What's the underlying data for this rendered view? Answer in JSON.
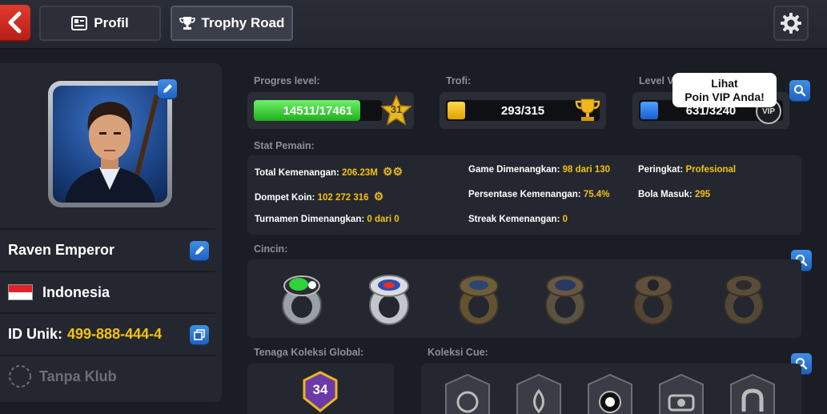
{
  "header": {
    "profil_label": "Profil",
    "trophy_road_label": "Trophy Road"
  },
  "player": {
    "name": "Raven Emperor",
    "country": "Indonesia",
    "id_label": "ID Unik:",
    "id_value": "499-888-444-4",
    "club": "Tanpa Klub"
  },
  "level": {
    "label": "Progres level:",
    "progress_text": "14511/17461",
    "progress_fraction": 0.831,
    "level_number": "31"
  },
  "trophy": {
    "label": "Trofi:",
    "value": "293/315"
  },
  "vip": {
    "label": "Level V",
    "value": "631/3240",
    "badge": "VIP",
    "tooltip_line1": "Lihat",
    "tooltip_line2": "Poin VIP Anda!"
  },
  "stats": {
    "label": "Stat Pemain:",
    "total_wins_label": "Total Kemenangan:",
    "total_wins_value": "206.23M",
    "wallet_label": "Dompet Koin:",
    "wallet_value": "102 272 316",
    "tournaments_label": "Turnamen Dimenangkan:",
    "tournaments_value": "0 dari 0",
    "games_label": "Game Dimenangkan:",
    "games_value": "98 dari 130",
    "win_pct_label": "Persentase Kemenangan:",
    "win_pct_value": "75.4%",
    "streak_label": "Streak Kemenangan:",
    "streak_value": "0",
    "rank_label": "Peringkat:",
    "rank_value": "Profesional",
    "balls_label": "Bola Masuk:",
    "balls_value": "295"
  },
  "rings": {
    "label": "Cincin:"
  },
  "global_power": {
    "label": "Tenaga Koleksi Global:",
    "value": "34"
  },
  "cue_collection": {
    "label": "Koleksi Cue:"
  },
  "colors": {
    "accent_gold": "#f4c20d",
    "button_blue": "#2a78d6",
    "progress_green": "#3bd136",
    "back_red": "#d12c22"
  }
}
